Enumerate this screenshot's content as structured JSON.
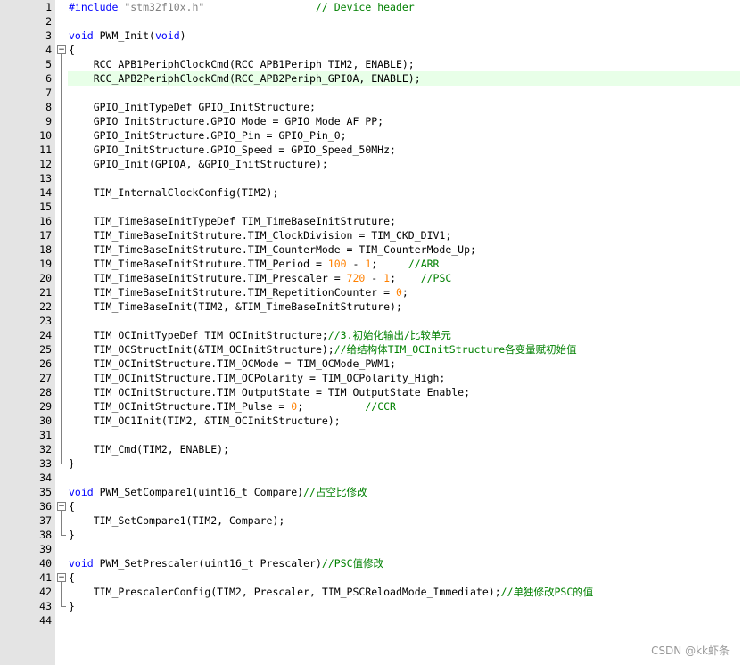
{
  "editor": {
    "lines": [
      {
        "n": "1",
        "segs": [
          {
            "t": "#include ",
            "c": "kw"
          },
          {
            "t": "\"stm32f10x.h\"",
            "c": "str"
          },
          {
            "t": "                  ",
            "c": ""
          },
          {
            "t": "// Device header",
            "c": "cm"
          }
        ]
      },
      {
        "n": "2",
        "segs": []
      },
      {
        "n": "3",
        "segs": [
          {
            "t": "void",
            "c": "kw"
          },
          {
            "t": " PWM_Init(",
            "c": ""
          },
          {
            "t": "void",
            "c": "kw"
          },
          {
            "t": ")",
            "c": ""
          }
        ]
      },
      {
        "n": "4",
        "segs": [
          {
            "t": "{",
            "c": ""
          }
        ],
        "fold": "open"
      },
      {
        "n": "5",
        "segs": [
          {
            "t": "    RCC_APB1PeriphClockCmd(RCC_APB1Periph_TIM2, ENABLE);",
            "c": ""
          }
        ]
      },
      {
        "n": "6",
        "segs": [
          {
            "t": "    RCC_APB2PeriphClockCmd(RCC_APB2Periph_GPIOA, ENABLE);",
            "c": ""
          }
        ],
        "current": true
      },
      {
        "n": "7",
        "segs": []
      },
      {
        "n": "8",
        "segs": [
          {
            "t": "    GPIO_InitTypeDef GPIO_InitStructure;",
            "c": ""
          }
        ]
      },
      {
        "n": "9",
        "segs": [
          {
            "t": "    GPIO_InitStructure.GPIO_Mode = GPIO_Mode_AF_PP;",
            "c": ""
          }
        ]
      },
      {
        "n": "10",
        "segs": [
          {
            "t": "    GPIO_InitStructure.GPIO_Pin = GPIO_Pin_0;",
            "c": ""
          }
        ]
      },
      {
        "n": "11",
        "segs": [
          {
            "t": "    GPIO_InitStructure.GPIO_Speed = GPIO_Speed_50MHz;",
            "c": ""
          }
        ]
      },
      {
        "n": "12",
        "segs": [
          {
            "t": "    GPIO_Init(GPIOA, &GPIO_InitStructure);",
            "c": ""
          }
        ]
      },
      {
        "n": "13",
        "segs": []
      },
      {
        "n": "14",
        "segs": [
          {
            "t": "    TIM_InternalClockConfig(TIM2);",
            "c": ""
          }
        ]
      },
      {
        "n": "15",
        "segs": []
      },
      {
        "n": "16",
        "segs": [
          {
            "t": "    TIM_TimeBaseInitTypeDef TIM_TimeBaseInitStruture;",
            "c": ""
          }
        ]
      },
      {
        "n": "17",
        "segs": [
          {
            "t": "    TIM_TimeBaseInitStruture.TIM_ClockDivision = TIM_CKD_DIV1;",
            "c": ""
          }
        ]
      },
      {
        "n": "18",
        "segs": [
          {
            "t": "    TIM_TimeBaseInitStruture.TIM_CounterMode = TIM_CounterMode_Up;",
            "c": ""
          }
        ]
      },
      {
        "n": "19",
        "segs": [
          {
            "t": "    TIM_TimeBaseInitStruture.TIM_Period = ",
            "c": ""
          },
          {
            "t": "100",
            "c": "num"
          },
          {
            "t": " - ",
            "c": ""
          },
          {
            "t": "1",
            "c": "num"
          },
          {
            "t": ";     ",
            "c": ""
          },
          {
            "t": "//ARR",
            "c": "cm"
          }
        ]
      },
      {
        "n": "20",
        "segs": [
          {
            "t": "    TIM_TimeBaseInitStruture.TIM_Prescaler = ",
            "c": ""
          },
          {
            "t": "720",
            "c": "num"
          },
          {
            "t": " - ",
            "c": ""
          },
          {
            "t": "1",
            "c": "num"
          },
          {
            "t": ";    ",
            "c": ""
          },
          {
            "t": "//PSC",
            "c": "cm"
          }
        ]
      },
      {
        "n": "21",
        "segs": [
          {
            "t": "    TIM_TimeBaseInitStruture.TIM_RepetitionCounter = ",
            "c": ""
          },
          {
            "t": "0",
            "c": "num"
          },
          {
            "t": ";",
            "c": ""
          }
        ]
      },
      {
        "n": "22",
        "segs": [
          {
            "t": "    TIM_TimeBaseInit(TIM2, &TIM_TimeBaseInitStruture);",
            "c": ""
          }
        ]
      },
      {
        "n": "23",
        "segs": []
      },
      {
        "n": "24",
        "segs": [
          {
            "t": "    TIM_OCInitTypeDef TIM_OCInitStructure;",
            "c": ""
          },
          {
            "t": "//3.初始化输出/比较单元",
            "c": "cm"
          }
        ]
      },
      {
        "n": "25",
        "segs": [
          {
            "t": "    TIM_OCStructInit(&TIM_OCInitStructure);",
            "c": ""
          },
          {
            "t": "//给结构体TIM_OCInitStructure各变量赋初始值",
            "c": "cm"
          }
        ]
      },
      {
        "n": "26",
        "segs": [
          {
            "t": "    TIM_OCInitStructure.TIM_OCMode = TIM_OCMode_PWM1;",
            "c": ""
          }
        ]
      },
      {
        "n": "27",
        "segs": [
          {
            "t": "    TIM_OCInitStructure.TIM_OCPolarity = TIM_OCPolarity_High;",
            "c": ""
          }
        ]
      },
      {
        "n": "28",
        "segs": [
          {
            "t": "    TIM_OCInitStructure.TIM_OutputState = TIM_OutputState_Enable;",
            "c": ""
          }
        ]
      },
      {
        "n": "29",
        "segs": [
          {
            "t": "    TIM_OCInitStructure.TIM_Pulse = ",
            "c": ""
          },
          {
            "t": "0",
            "c": "num"
          },
          {
            "t": ";          ",
            "c": ""
          },
          {
            "t": "//CCR",
            "c": "cm"
          }
        ]
      },
      {
        "n": "30",
        "segs": [
          {
            "t": "    TIM_OC1Init(TIM2, &TIM_OCInitStructure);",
            "c": ""
          }
        ]
      },
      {
        "n": "31",
        "segs": []
      },
      {
        "n": "32",
        "segs": [
          {
            "t": "    TIM_Cmd(TIM2, ENABLE);",
            "c": ""
          }
        ]
      },
      {
        "n": "33",
        "segs": [
          {
            "t": "}",
            "c": ""
          }
        ],
        "fold": "end"
      },
      {
        "n": "34",
        "segs": []
      },
      {
        "n": "35",
        "segs": [
          {
            "t": "void",
            "c": "kw"
          },
          {
            "t": " PWM_SetCompare1(uint16_t Compare)",
            "c": ""
          },
          {
            "t": "//占空比修改",
            "c": "cm"
          }
        ]
      },
      {
        "n": "36",
        "segs": [
          {
            "t": "{",
            "c": ""
          }
        ],
        "fold": "open"
      },
      {
        "n": "37",
        "segs": [
          {
            "t": "    TIM_SetCompare1(TIM2, Compare);",
            "c": ""
          }
        ]
      },
      {
        "n": "38",
        "segs": [
          {
            "t": "}",
            "c": ""
          }
        ],
        "fold": "end"
      },
      {
        "n": "39",
        "segs": []
      },
      {
        "n": "40",
        "segs": [
          {
            "t": "void",
            "c": "kw"
          },
          {
            "t": " PWM_SetPrescaler(uint16_t Prescaler)",
            "c": ""
          },
          {
            "t": "//PSC值修改",
            "c": "cm"
          }
        ]
      },
      {
        "n": "41",
        "segs": [
          {
            "t": "{",
            "c": ""
          }
        ],
        "fold": "open"
      },
      {
        "n": "42",
        "segs": [
          {
            "t": "    TIM_PrescalerConfig(TIM2, Prescaler, TIM_PSCReloadMode_Immediate);",
            "c": ""
          },
          {
            "t": "//单独修改PSC的值",
            "c": "cm"
          }
        ]
      },
      {
        "n": "43",
        "segs": [
          {
            "t": "}",
            "c": ""
          }
        ],
        "fold": "end"
      },
      {
        "n": "44",
        "segs": []
      }
    ]
  },
  "watermark": "CSDN @kk虾条",
  "colors": {
    "keyword": "#0000ff",
    "string": "#808080",
    "comment": "#008000",
    "number": "#ff8000",
    "current_line": "#e8ffe8",
    "gutter": "#e4e4e4"
  }
}
